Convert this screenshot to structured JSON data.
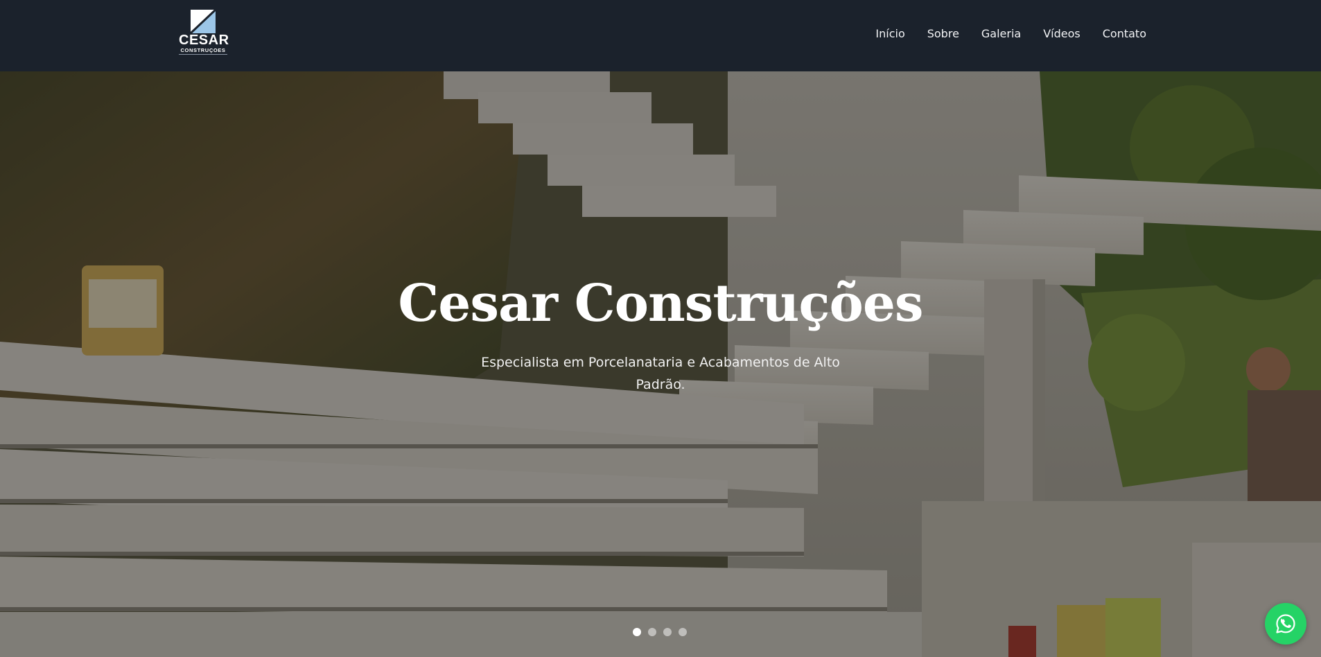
{
  "brand": {
    "name": "CESAR",
    "sub": "CONSTRUÇOES",
    "logo_icon": "diagonal-square-logo-icon"
  },
  "nav": {
    "items": [
      {
        "label": "Início"
      },
      {
        "label": "Sobre"
      },
      {
        "label": "Galeria"
      },
      {
        "label": "Vídeos"
      },
      {
        "label": "Contato"
      }
    ]
  },
  "hero": {
    "title": "Cesar Construções",
    "subtitle": "Especialista em Porcelanataria e Acabamentos de Alto Padrão.",
    "background": "photo of white floating concrete stairs on a grassy hillside",
    "slides": 4,
    "active_slide": 1
  },
  "floating": {
    "whatsapp_icon": "whatsapp-icon"
  },
  "colors": {
    "navbar": "#1b222c",
    "text": "#ffffff",
    "whatsapp": "#25d366"
  }
}
